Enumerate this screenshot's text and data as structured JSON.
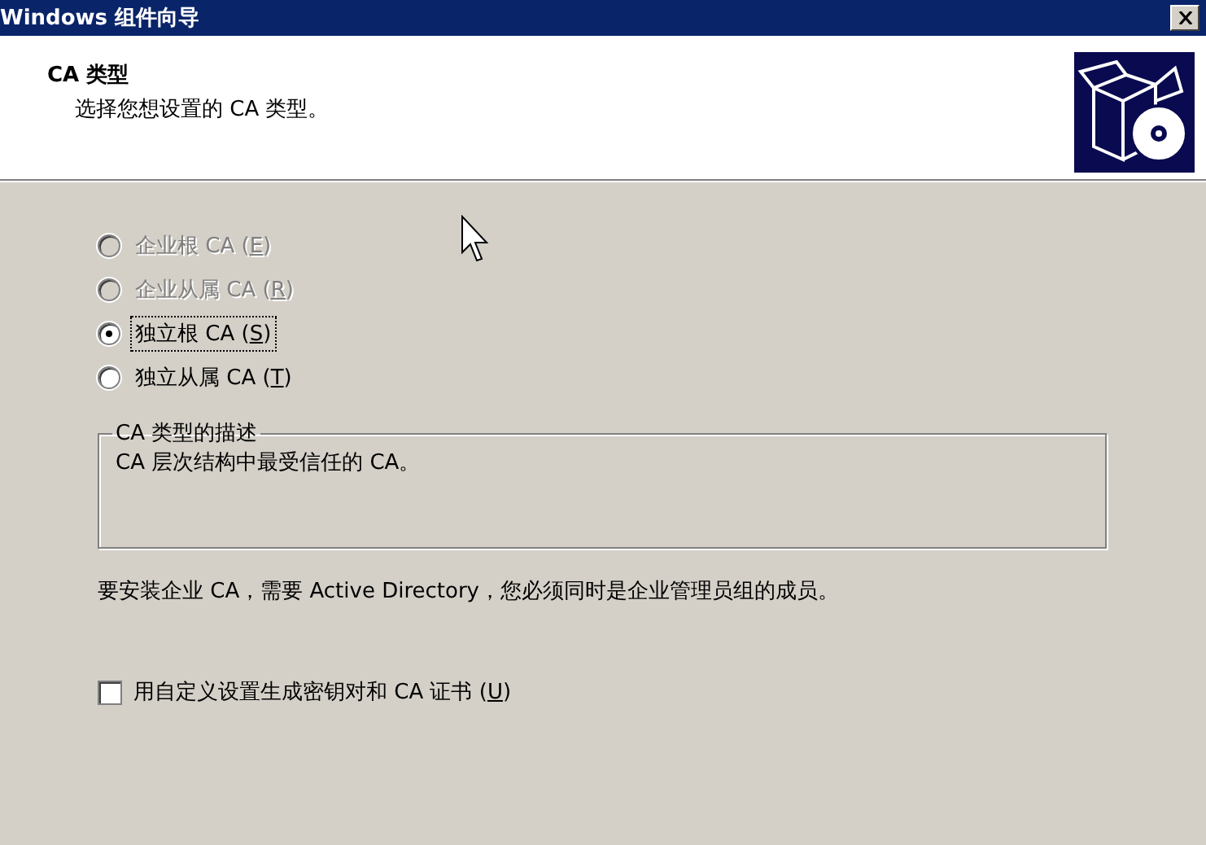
{
  "window": {
    "title": "Windows 组件向导"
  },
  "header": {
    "title": "CA 类型",
    "subtitle": "选择您想设置的 CA 类型。"
  },
  "ca_types": [
    {
      "label": "企业根 CA",
      "mnemonic": "(E)",
      "selected": false,
      "disabled": true,
      "focused": false
    },
    {
      "label": "企业从属 CA",
      "mnemonic": "(R)",
      "selected": false,
      "disabled": true,
      "focused": false
    },
    {
      "label": "独立根 CA",
      "mnemonic": "(S)",
      "selected": true,
      "disabled": false,
      "focused": true
    },
    {
      "label": "独立从属 CA",
      "mnemonic": "(T)",
      "selected": false,
      "disabled": false,
      "focused": false
    }
  ],
  "description": {
    "legend": "CA 类型的描述",
    "text": "CA 层次结构中最受信任的 CA。"
  },
  "note": "要安装企业 CA，需要 Active Directory，您必须同时是企业管理员组的成员。",
  "custom_keys": {
    "label": "用自定义设置生成密钥对和 CA 证书",
    "mnemonic": "(U)",
    "checked": false
  }
}
